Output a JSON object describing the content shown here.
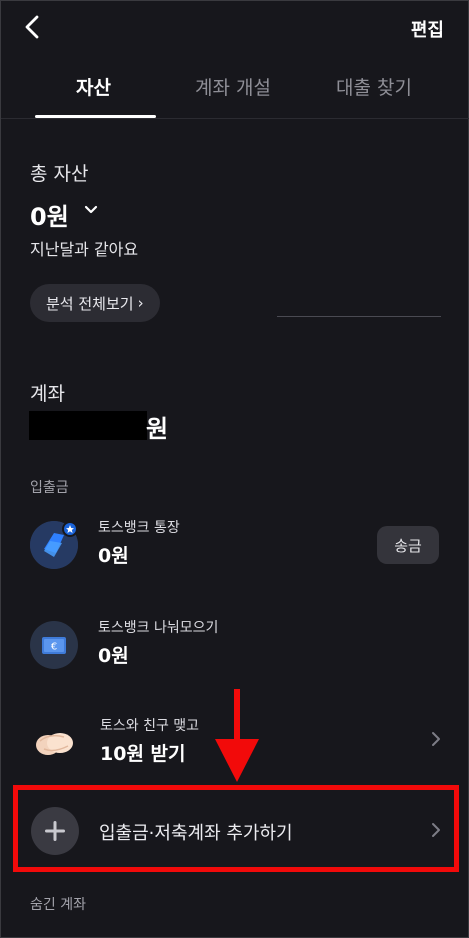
{
  "header": {
    "edit_label": "편집"
  },
  "tabs": [
    {
      "label": "자산",
      "active": true
    },
    {
      "label": "계좌 개설",
      "active": false
    },
    {
      "label": "대출 찾기",
      "active": false
    }
  ],
  "total": {
    "title": "총 자산",
    "amount": "0원",
    "subtitle": "지난달과 같아요",
    "analysis_button": "분석 전체보기",
    "analysis_arrow": "›"
  },
  "accounts": {
    "title": "계좌",
    "amount_unit": "원",
    "group_label": "입출금",
    "items": [
      {
        "name": "토스뱅크 통장",
        "amount": "0원",
        "action": "송금",
        "icon": "toss-bank-logo-icon"
      },
      {
        "name": "토스뱅크 나눠모으기",
        "amount": "0원",
        "icon": "euro-card-icon"
      },
      {
        "name": "토스와 친구 맺고",
        "amount": "10원 받기",
        "icon": "handshake-icon"
      }
    ],
    "add_label": "입출금·저축계좌 추가하기",
    "hidden_label": "숨긴 계좌"
  },
  "colors": {
    "background": "#17171c",
    "annotation_red": "#f20a0a",
    "toss_blue": "#1b64da"
  }
}
